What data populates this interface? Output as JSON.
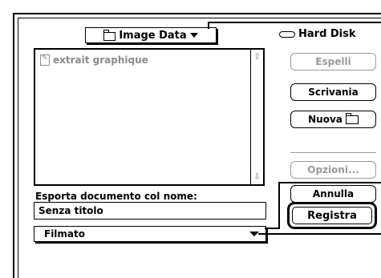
{
  "folder_popup": {
    "label": "Image Data",
    "icon": "folder-icon"
  },
  "disk": {
    "label": "Hard Disk",
    "icon": "hard-disk-icon"
  },
  "file_list": {
    "items": [
      {
        "label": "extrait graphique",
        "icon": "document-icon",
        "enabled": false
      }
    ]
  },
  "buttons": {
    "eject": "Espelli",
    "desktop": "Scrivania",
    "new_folder": "Nuova",
    "options": "Opzioni...",
    "cancel": "Annulla",
    "save": "Registra"
  },
  "save_prompt": "Esporta documento col nome:",
  "filename": {
    "value": "Senza titolo"
  },
  "format_popup": {
    "label": "Filmato"
  },
  "colors": {
    "text": "#000000",
    "disabled": "#9a9a9a",
    "background": "#ffffff"
  }
}
